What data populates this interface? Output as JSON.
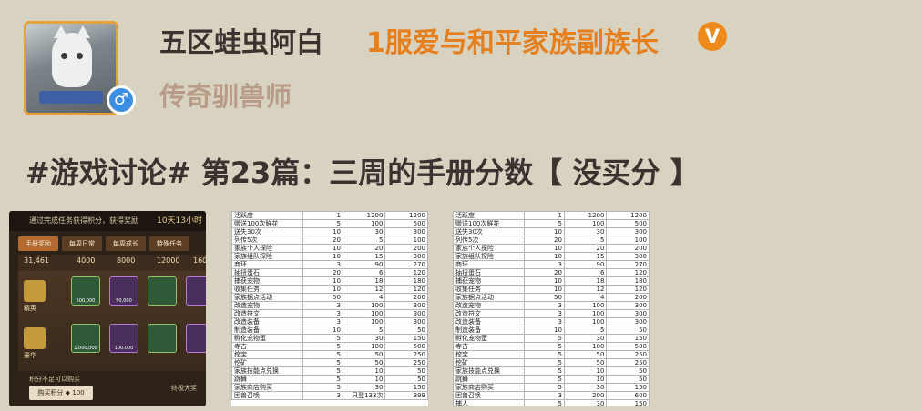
{
  "user": {
    "name": "五区蛙虫阿白",
    "title": "1服爱与和平家族副族长",
    "verified_label": "V",
    "subtitle": "传奇驯兽师",
    "gender_icon": "♂"
  },
  "post": {
    "title": "#游戏讨论# 第23篇：三周的手册分数【 没买分 】"
  },
  "game_screenshot": {
    "header_text": "通过完成任务获得积分，获得奖励",
    "countdown": "10天13小时",
    "tabs": [
      "手册奖励",
      "每周日常",
      "每周成长",
      "特殊任务"
    ],
    "points": "31,461",
    "milestones": [
      "4000",
      "8000",
      "12000",
      "1600"
    ],
    "tier_labels": [
      "精英",
      "豪华"
    ],
    "item_values": [
      "500,000",
      "50,000",
      "1,000,000",
      "100,000"
    ],
    "footer_label": "积分不足可以购买",
    "buy_button": "购买积分",
    "buy_amount": "100",
    "rank_text": "终极大奖"
  },
  "sheet1": {
    "rows": [
      [
        "活跃度",
        "1",
        "1200",
        "1200"
      ],
      [
        "赠送100次鲜花",
        "5",
        "100",
        "500"
      ],
      [
        "送失30次",
        "10",
        "30",
        "300"
      ],
      [
        "列传5次",
        "20",
        "5",
        "100"
      ],
      [
        "家族个人探险",
        "10",
        "20",
        "200"
      ],
      [
        "家族组队探险",
        "10",
        "15",
        "300"
      ],
      [
        "商环",
        "3",
        "90",
        "270"
      ],
      [
        "抽扭蛋石",
        "20",
        "6",
        "120"
      ],
      [
        "捕获宠物",
        "10",
        "18",
        "180"
      ],
      [
        "收集任务",
        "10",
        "12",
        "120"
      ],
      [
        "家族据点活动",
        "50",
        "4",
        "200"
      ],
      [
        "改造宠物",
        "3",
        "100",
        "300"
      ],
      [
        "改造符文",
        "3",
        "100",
        "300"
      ],
      [
        "改造装备",
        "3",
        "100",
        "300"
      ],
      [
        "制造装备",
        "10",
        "5",
        "50"
      ],
      [
        "孵化宠物蛋",
        "5",
        "30",
        "150"
      ],
      [
        "寺古",
        "5",
        "100",
        "500"
      ],
      [
        "挖宝",
        "5",
        "50",
        "250"
      ],
      [
        "挖矿",
        "5",
        "50",
        "250"
      ],
      [
        "家族技能点兑换",
        "5",
        "10",
        "50"
      ],
      [
        "跳舞",
        "5",
        "10",
        "50"
      ],
      [
        "家族商店购买",
        "5",
        "30",
        "150"
      ],
      [
        "困兽召唤",
        "3",
        "只登133次",
        "399"
      ]
    ]
  },
  "sheet2": {
    "rows": [
      [
        "活跃度",
        "1",
        "1200",
        "1200"
      ],
      [
        "赠送100次鲜花",
        "5",
        "100",
        "500"
      ],
      [
        "送失30次",
        "10",
        "30",
        "300"
      ],
      [
        "列传5次",
        "20",
        "5",
        "100"
      ],
      [
        "家族个人探险",
        "10",
        "20",
        "200"
      ],
      [
        "家族组队探险",
        "10",
        "15",
        "300"
      ],
      [
        "商环",
        "3",
        "90",
        "270"
      ],
      [
        "抽扭蛋石",
        "20",
        "6",
        "120"
      ],
      [
        "捕获宠物",
        "10",
        "18",
        "180"
      ],
      [
        "收集任务",
        "10",
        "12",
        "120"
      ],
      [
        "家族据点活动",
        "50",
        "4",
        "200"
      ],
      [
        "改造宠物",
        "3",
        "100",
        "300"
      ],
      [
        "改造符文",
        "3",
        "100",
        "300"
      ],
      [
        "改造装备",
        "3",
        "100",
        "300"
      ],
      [
        "制造装备",
        "10",
        "5",
        "50"
      ],
      [
        "孵化宠物蛋",
        "5",
        "30",
        "150"
      ],
      [
        "寺古",
        "5",
        "100",
        "500"
      ],
      [
        "挖宝",
        "5",
        "50",
        "250"
      ],
      [
        "挖矿",
        "5",
        "50",
        "250"
      ],
      [
        "家族技能点兑换",
        "5",
        "10",
        "50"
      ],
      [
        "跳舞",
        "5",
        "10",
        "50"
      ],
      [
        "家族商店购买",
        "5",
        "30",
        "150"
      ],
      [
        "困兽召唤",
        "3",
        "200",
        "600"
      ],
      [
        "捕人",
        "5",
        "30",
        "150"
      ]
    ]
  }
}
